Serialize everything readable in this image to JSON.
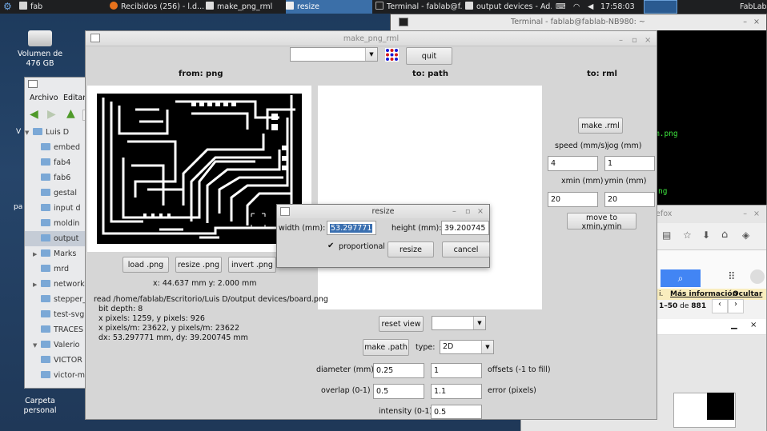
{
  "taskbar": {
    "tasks": [
      "fab",
      "Recibidos (256) - l.d...",
      "make_png_rml",
      "resize",
      "Terminal - fablab@f...",
      "output devices - Ad..."
    ],
    "clock": "17:58:03",
    "user": "FabLab"
  },
  "desktop": {
    "volume_label": "Volumen de 476 GB",
    "home_label": "Carpeta personal"
  },
  "file_manager": {
    "menu": [
      "Archivo",
      "Editar"
    ],
    "root": "Luis D",
    "items": [
      "embed",
      "fab4",
      "fab6",
      "gestal",
      "input d",
      "moldin",
      "output",
      "Marks",
      "mrd",
      "networki",
      "stepper_r",
      "test-svg",
      "TRACES",
      "Valerio",
      "VICTOR",
      "victor-mo"
    ]
  },
  "terminal": {
    "title": "Terminal - fablab@fablab-NB980: ~",
    "lines": [
      "m.png",
      "ng"
    ]
  },
  "firefox": {
    "title_fragment": "efox",
    "more_info": "Más información",
    "hide": "Ocultar",
    "notice_fragment": "i.",
    "range": "1–50",
    "of_text": "de",
    "total": "881"
  },
  "main_window": {
    "title": "make_png_rml",
    "quit_label": "quit",
    "headers": {
      "from": "from: png",
      "to_path": "to: path",
      "to_rml": "to: rml"
    },
    "buttons": {
      "load": "load .png",
      "resize": "resize .png",
      "invert": "invert .png",
      "make_rml": "make .rml",
      "move": "move to xmin,ymin",
      "reset_view": "reset view",
      "make_path": "make .path"
    },
    "coords": "x: 44.637 mm  y: 2.000 mm",
    "info": [
      "read /home/fablab/Escritorio/Luis D/output devices/board.png",
      "bit depth: 8",
      "x pixels: 1259, y pixels: 926",
      "x pixels/m: 23622, y pixels/m: 23622",
      "dx: 53.297771 mm, dy: 39.200745 mm"
    ],
    "rml": {
      "speed_label": "speed (mm/s)",
      "jog_label": "jog (mm)",
      "speed": "4",
      "jog": "1",
      "xmin_label": "xmin (mm)",
      "ymin_label": "ymin (mm)",
      "xmin": "20",
      "ymin": "20"
    },
    "path": {
      "type_label": "type:",
      "type_value": "2D",
      "diameter_label": "diameter (mm)",
      "diameter": "0.25",
      "offsets": "1",
      "offsets_label": "offsets (-1 to fill)",
      "overlap_label": "overlap (0-1)",
      "overlap": "0.5",
      "error": "1.1",
      "error_label": "error (pixels)",
      "intensity_label": "intensity (0-1)",
      "intensity": "0.5"
    }
  },
  "resize_dialog": {
    "title": "resize",
    "width_label": "width (mm):",
    "width": "53.297771",
    "height_label": "height (mm):",
    "height": "39.200745",
    "proportional_label": "proportional",
    "resize_label": "resize",
    "cancel_label": "cancel"
  }
}
